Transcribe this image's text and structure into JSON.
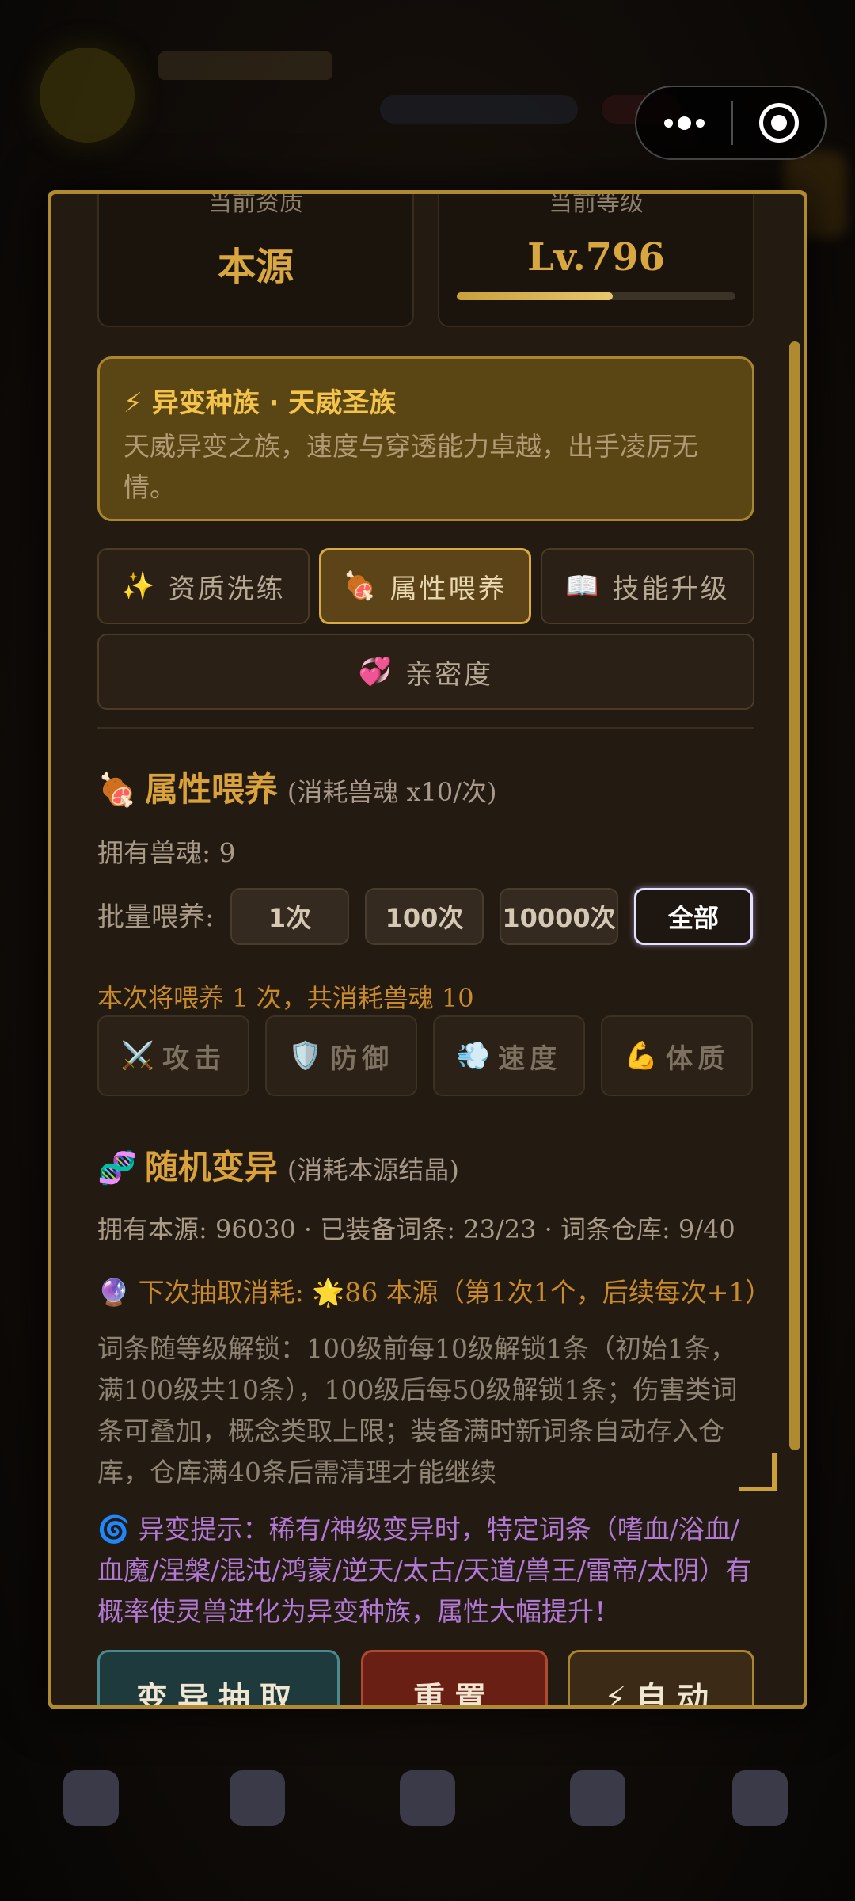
{
  "modal": {
    "stats": {
      "aptitude_label": "当前资质",
      "aptitude_value": "本源",
      "level_label": "当前等级",
      "level_value": "Lv.796",
      "level_progress": 0.56
    },
    "mutation": {
      "title": "⚡ 异变种族 · 天威圣族",
      "description": "天威异变之族，速度与穿透能力卓越，出手凌厉无情。"
    },
    "tabs": [
      {
        "icon": "✨",
        "label": "资质洗练"
      },
      {
        "icon": "🍖",
        "label": "属性喂养"
      },
      {
        "icon": "📖",
        "label": "技能升级"
      },
      {
        "icon": "💞",
        "label": "亲密度"
      }
    ],
    "active_tab": 1,
    "feed": {
      "icon": "🍖",
      "title": "属性喂养",
      "subtitle": "(消耗兽魂 x10/次)",
      "owned": "拥有兽魂: 9",
      "batch_label": "批量喂养:",
      "batch_options": [
        "1次",
        "100次",
        "10000次",
        "全部"
      ],
      "selected_batch": 3,
      "summary": "本次将喂养 1 次，共消耗兽魂 10",
      "attributes": [
        {
          "icon": "⚔️",
          "label": "攻击"
        },
        {
          "icon": "🛡️",
          "label": "防御"
        },
        {
          "icon": "💨",
          "label": "速度"
        },
        {
          "icon": "💪",
          "label": "体质"
        }
      ]
    },
    "mutate": {
      "icon": "🧬",
      "title": "随机变异",
      "subtitle": "(消耗本源结晶)",
      "status": "拥有本源: 96030 · 已装备词条: 23/23 · 词条仓库: 9/40",
      "next_cost": "🔮 下次抽取消耗: 🌟86 本源（第1次1个，后续每次+1）",
      "rules": "词条随等级解锁：100级前每10级解锁1条（初始1条，满100级共10条），100级后每50级解锁1条；伤害类词条可叠加，概念类取上限；装备满时新词条自动存入仓库，仓库满40条后需清理才能继续",
      "hint": "🌀 异变提示：稀有/神级变异时，特定词条（嗜血/浴血/血魔/涅槃/混沌/鸿蒙/逆天/太古/天道/兽王/雷帝/太阴）有概率使灵兽进化为异变种族，属性大幅提升！"
    },
    "actions": [
      {
        "label": "变异抽取",
        "color": "#1f3a3c",
        "border": "#4a8a8e"
      },
      {
        "label": "重置",
        "color": "#6a1f14",
        "border": "#b04a2e"
      },
      {
        "label": "⚡自动",
        "color": "#3a2a16",
        "border": "#a8852e"
      }
    ]
  },
  "colors": {
    "accent_gold": "#d9a740",
    "modal_border": "#b08a2e",
    "hint_purple": "#b27ad4",
    "note_orange": "#c98a2a"
  }
}
